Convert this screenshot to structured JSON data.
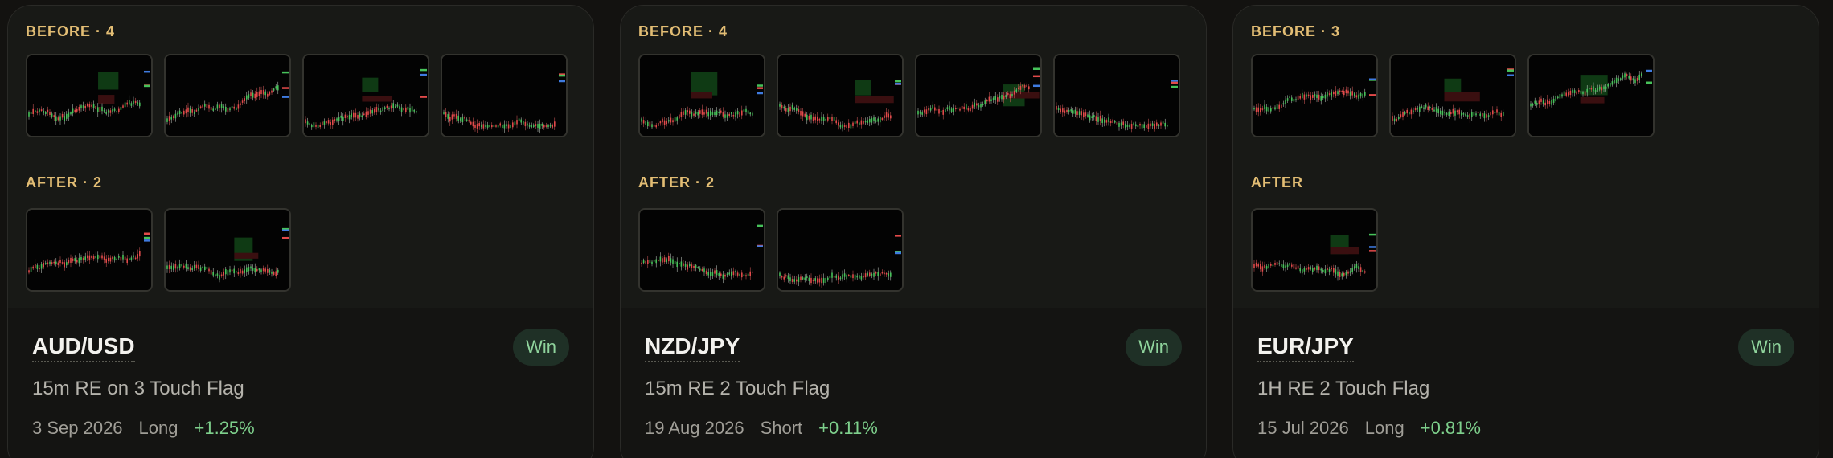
{
  "colors": {
    "background": "#131210",
    "section_label": "#e2bd74",
    "win_badge_bg": "#1f3026",
    "win_text": "#8fd39c",
    "positive": "#7ed08c"
  },
  "cards": [
    {
      "before_label": "BEFORE · 4",
      "after_label": "AFTER · 2",
      "before_count": 4,
      "after_count": 2,
      "pair": "AUD/USD",
      "result": "Win",
      "setup": "15m RE on 3 Touch Flag",
      "date": "3 Sep 2026",
      "direction": "Long",
      "pnl": "+1.25%"
    },
    {
      "before_label": "BEFORE · 4",
      "after_label": "AFTER · 2",
      "before_count": 4,
      "after_count": 2,
      "pair": "NZD/JPY",
      "result": "Win",
      "setup": "15m RE 2 Touch Flag",
      "date": "19 Aug 2026",
      "direction": "Short",
      "pnl": "+0.11%"
    },
    {
      "before_label": "BEFORE · 3",
      "after_label": "AFTER",
      "before_count": 3,
      "after_count": 1,
      "pair": "EUR/JPY",
      "result": "Win",
      "setup": "1H RE 2 Touch Flag",
      "date": "15 Jul 2026",
      "direction": "Long",
      "pnl": "+0.81%"
    }
  ]
}
